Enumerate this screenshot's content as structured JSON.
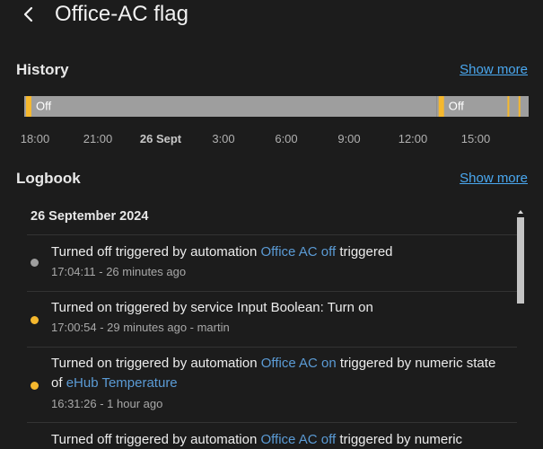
{
  "header": {
    "title": "Office-AC flag"
  },
  "history": {
    "title": "History",
    "show_more": "Show more",
    "timeline": {
      "segments": [
        {
          "label": "Off",
          "start": 0.0,
          "end": 0.818,
          "color": "#9e9e9e"
        },
        {
          "label": "Off",
          "start": 0.818,
          "end": 1.0,
          "color": "#9e9e9e"
        }
      ],
      "on_markers": [
        0.0,
        0.818,
        0.958,
        0.98
      ],
      "on_color": "#f5b82e"
    },
    "ticks": [
      "18:00",
      "21:00",
      "26 Sept",
      "3:00",
      "6:00",
      "9:00",
      "12:00",
      "15:00"
    ]
  },
  "logbook": {
    "title": "Logbook",
    "show_more": "Show more",
    "date": "26 September 2024",
    "entries": [
      {
        "dot_color": "#9e9e9e",
        "parts": [
          {
            "text": "Turned off triggered by automation "
          },
          {
            "text": "Office AC off",
            "link": true
          },
          {
            "text": " triggered"
          }
        ],
        "meta": "17:04:11 - 26 minutes ago"
      },
      {
        "dot_color": "#f5b82e",
        "parts": [
          {
            "text": "Turned on triggered by service Input Boolean: Turn on"
          }
        ],
        "meta": "17:00:54 - 29 minutes ago - martin"
      },
      {
        "dot_color": "#f5b82e",
        "parts": [
          {
            "text": "Turned on triggered by automation "
          },
          {
            "text": "Office AC on",
            "link": true
          },
          {
            "text": " triggered by numeric state of "
          },
          {
            "text": "eHub Temperature",
            "link": true
          }
        ],
        "meta": "16:31:26 - 1 hour ago"
      },
      {
        "dot_color": "#9e9e9e",
        "parts": [
          {
            "text": "Turned off triggered by automation "
          },
          {
            "text": "Office AC off",
            "link": true
          },
          {
            "text": " triggered by numeric"
          }
        ],
        "meta": ""
      }
    ]
  }
}
